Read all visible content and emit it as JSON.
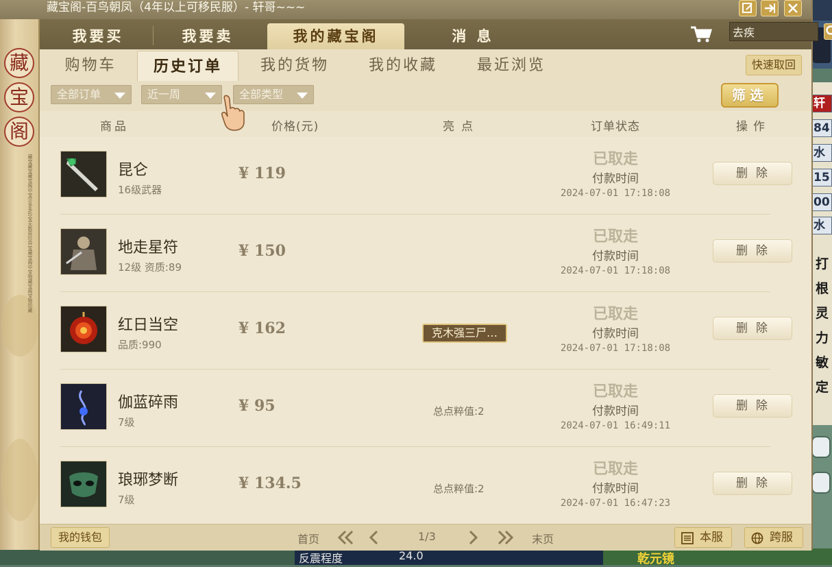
{
  "window": {
    "title": "藏宝阁-百鸟朝凤（4年以上可移民服）- 轩哥~~~",
    "side_chars": [
      "藏",
      "宝",
      "阁"
    ],
    "side_poem": "藏宝藏宝藏宝阁中宝贝多多珍宝无数奇珍异宝藏宝阁中宝物藏宝阁宝物珍藏"
  },
  "main_tabs": [
    {
      "label": "我要买",
      "active": false
    },
    {
      "label": "我要卖",
      "active": false
    },
    {
      "label": "我的藏宝阁",
      "active": true
    },
    {
      "label": "消 息",
      "active": false
    }
  ],
  "search": {
    "value": "去疾",
    "icon": "search-icon"
  },
  "sub_tabs": [
    {
      "label": "购物车",
      "active": false
    },
    {
      "label": "历史订单",
      "active": true
    },
    {
      "label": "我的货物",
      "active": false
    },
    {
      "label": "我的收藏",
      "active": false
    },
    {
      "label": "最近浏览",
      "active": false
    }
  ],
  "quick_retrieve": "快速取回",
  "filters": {
    "order": "全部订单",
    "period": "近一周",
    "type": "全部类型",
    "filter_btn": "筛选"
  },
  "table": {
    "headers": [
      "商品",
      "价格(元)",
      "亮点",
      "订单状态",
      "操作"
    ],
    "rows": [
      {
        "name": "昆仑",
        "desc": "16级武器",
        "price": "¥ 119",
        "highlight": "",
        "highlight_style": "none",
        "status": "已取走",
        "paid_label": "付款时间",
        "paid_time": "2024-07-01 17:18:08",
        "action": "删除",
        "thumb": "sword"
      },
      {
        "name": "地走星符",
        "desc": "12级 资质:89",
        "price": "¥ 150",
        "highlight": "",
        "highlight_style": "none",
        "status": "已取走",
        "paid_label": "付款时间",
        "paid_time": "2024-07-01 17:18:08",
        "action": "删除",
        "thumb": "warrior"
      },
      {
        "name": "红日当空",
        "desc": "品质:990",
        "price": "¥ 162",
        "highlight": "克木强三尸…",
        "highlight_style": "tag",
        "status": "已取走",
        "paid_label": "付款时间",
        "paid_time": "2024-07-01 17:18:08",
        "action": "删除",
        "thumb": "sun"
      },
      {
        "name": "伽蓝碎雨",
        "desc": "7级",
        "price": "¥ 95",
        "highlight": "总点粹值:2",
        "highlight_style": "text",
        "status": "已取走",
        "paid_label": "付款时间",
        "paid_time": "2024-07-01 16:49:11",
        "action": "删除",
        "thumb": "spirit"
      },
      {
        "name": "琅琊梦断",
        "desc": "7级",
        "price": "¥ 134.5",
        "highlight": "总点粹值:2",
        "highlight_style": "text",
        "status": "已取走",
        "paid_label": "付款时间",
        "paid_time": "2024-07-01 16:47:23",
        "action": "删除",
        "thumb": "mask"
      }
    ]
  },
  "footer": {
    "wallet": "我的钱包",
    "first": "首页",
    "page": "1/3",
    "last": "末页",
    "this_server": "本服",
    "cross_server": "跨服"
  },
  "background_game": {
    "stats": [
      "轩",
      "84",
      "水",
      "15",
      "00",
      "水"
    ],
    "vertical_chars": [
      "打",
      "根",
      "灵",
      "力",
      "敏",
      "定"
    ],
    "bottom_label": "反震程度",
    "bottom_value": "24.0",
    "bottom_gold": "乾元镜"
  },
  "colors": {
    "accent_gold": "#c9a24d",
    "status_gray": "#bdb39a",
    "title_bar": "#877b5c"
  }
}
